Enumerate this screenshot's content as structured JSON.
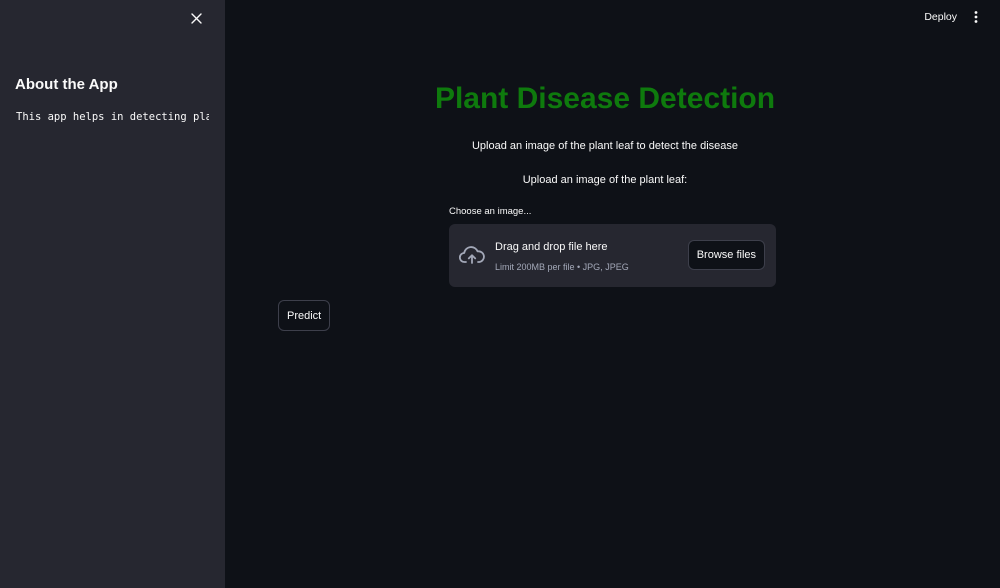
{
  "sidebar": {
    "close_icon": "close-icon",
    "title": "About the App",
    "text": "This app helps in detecting plant diseases"
  },
  "header": {
    "deploy_label": "Deploy",
    "menu_icon": "more-vertical-icon"
  },
  "main": {
    "title": "Plant Disease Detection",
    "title_color": "#0e7a0d",
    "subtitle": "Upload an image of the plant leaf to detect the disease",
    "upload_prompt": "Upload an image of the plant leaf:",
    "uploader": {
      "label": "Choose an image...",
      "icon": "cloud-upload-icon",
      "drag_text": "Drag and drop file here",
      "limit_text": "Limit 200MB per file • JPG, JPEG",
      "browse_label": "Browse files"
    },
    "predict_label": "Predict"
  },
  "colors": {
    "background": "#0e1117",
    "sidebar": "#262730",
    "text": "#fafafa",
    "muted_text": "#a3a8b8"
  }
}
